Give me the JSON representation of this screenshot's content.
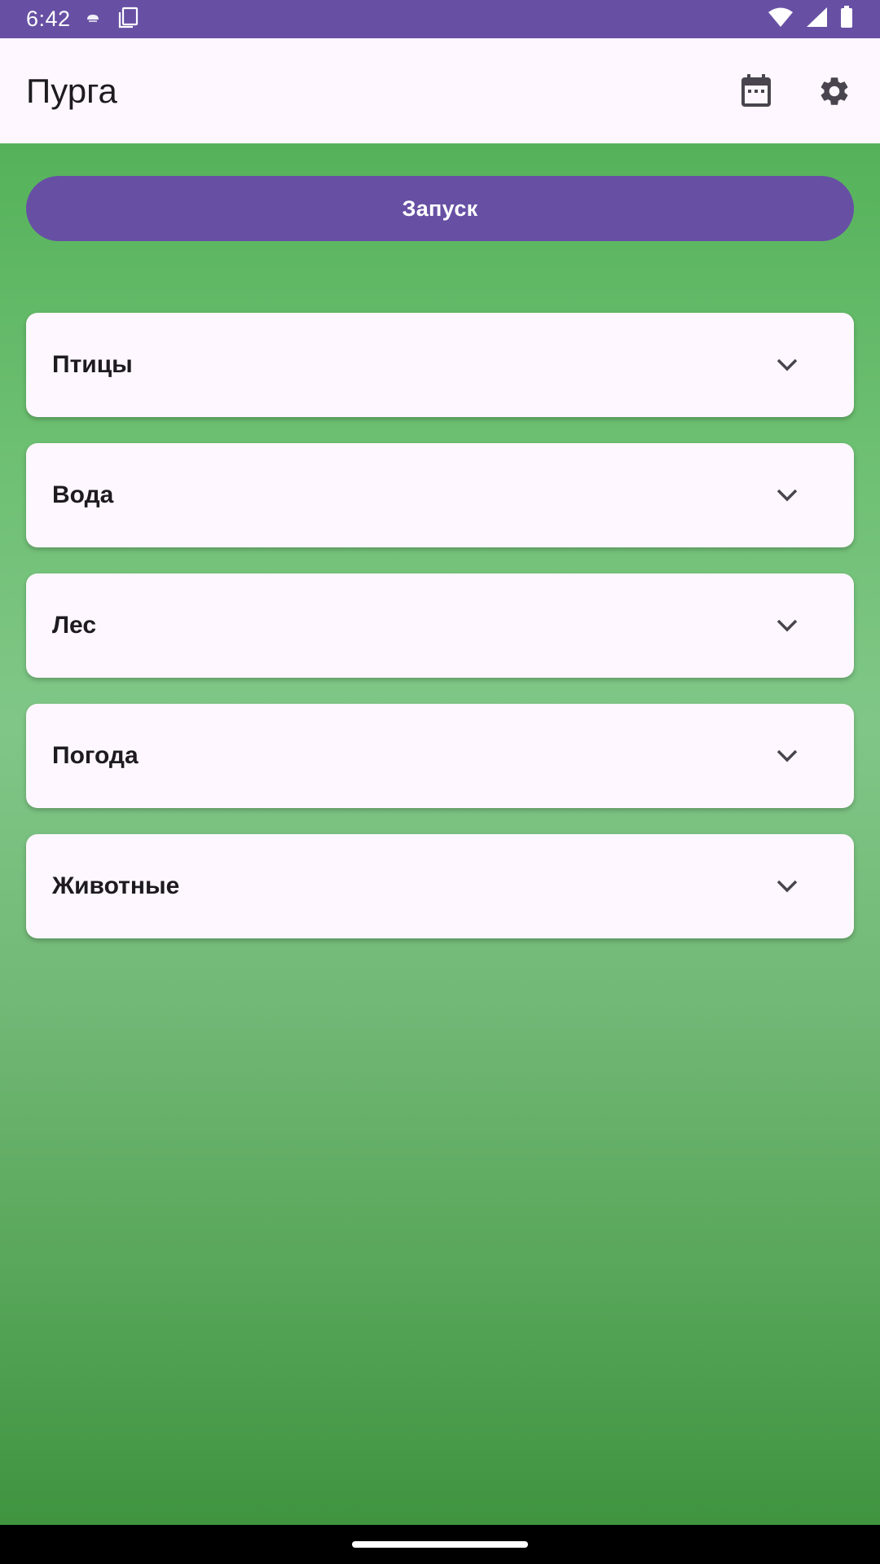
{
  "status_bar": {
    "time": "6:42",
    "left_icons": [
      "weather-icon",
      "clipboard-icon"
    ],
    "right_icons": [
      "wifi-icon",
      "cell-signal-icon",
      "battery-icon"
    ],
    "color": "#6750A4"
  },
  "app_bar": {
    "title": "Пурга",
    "actions": [
      "calendar-icon",
      "gear-icon"
    ]
  },
  "main": {
    "launch_label": "Запуск",
    "sections": [
      {
        "label": "Птицы",
        "icon": "chevron-down-icon"
      },
      {
        "label": "Вода",
        "icon": "chevron-down-icon"
      },
      {
        "label": "Лес",
        "icon": "chevron-down-icon"
      },
      {
        "label": "Погода",
        "icon": "chevron-down-icon"
      },
      {
        "label": "Животные",
        "icon": "chevron-down-icon"
      }
    ]
  },
  "colors": {
    "accent": "#6750A4",
    "surface": "#FEF7FF",
    "background_green": "#5DAA5F"
  }
}
